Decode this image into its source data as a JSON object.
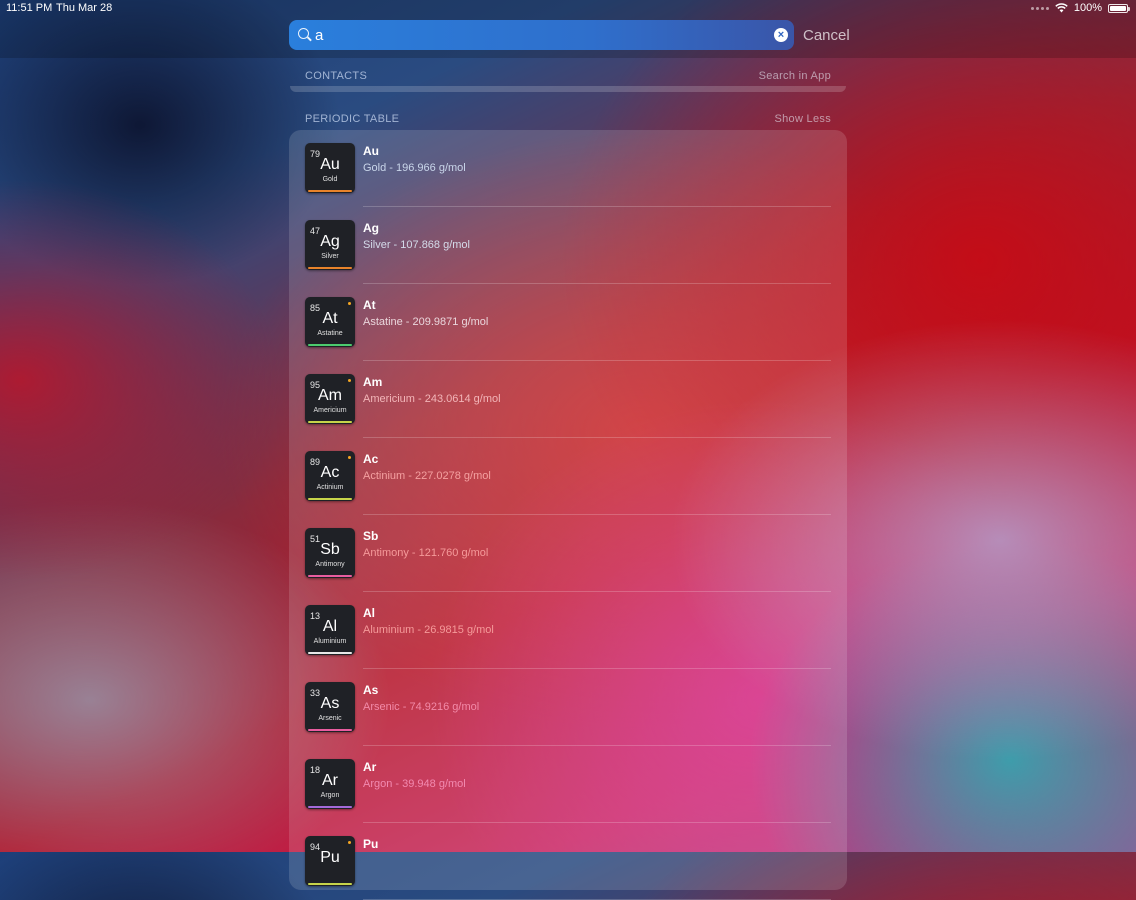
{
  "status_bar": {
    "time": "11:51 PM",
    "date": "Thu Mar 28",
    "battery": "100%"
  },
  "search": {
    "value": "a",
    "cancel_label": "Cancel",
    "clear_icon": "×"
  },
  "contacts_section": {
    "title": "CONTACTS",
    "action": "Search in App"
  },
  "periodic_section": {
    "title": "PERIODIC TABLE",
    "action": "Show Less"
  },
  "results": [
    {
      "number": "79",
      "symbol": "Au",
      "name": "Gold",
      "subtitle": "Gold - 196.966 g/mol",
      "bar_color": "#e8832a",
      "sub_color": "#c9d6ea",
      "dot": false
    },
    {
      "number": "47",
      "symbol": "Ag",
      "name": "Silver",
      "subtitle": "Silver - 107.868 g/mol",
      "bar_color": "#e8832a",
      "sub_color": "#d4dbea",
      "dot": false
    },
    {
      "number": "85",
      "symbol": "At",
      "name": "Astatine",
      "subtitle": "Astatine - 209.9871 g/mol",
      "bar_color": "#4ccb6e",
      "sub_color": "#ead6dc",
      "dot": true
    },
    {
      "number": "95",
      "symbol": "Am",
      "name": "Americium",
      "subtitle": "Americium - 243.0614 g/mol",
      "bar_color": "#c6d44a",
      "sub_color": "#f2b5b8",
      "dot": true
    },
    {
      "number": "89",
      "symbol": "Ac",
      "name": "Actinium",
      "subtitle": "Actinium - 227.0278 g/mol",
      "bar_color": "#c6d44a",
      "sub_color": "#f4a0a0",
      "dot": true
    },
    {
      "number": "51",
      "symbol": "Sb",
      "name": "Antimony",
      "subtitle": "Antimony - 121.760 g/mol",
      "bar_color": "#e95da0",
      "sub_color": "#f59a9a",
      "dot": false
    },
    {
      "number": "13",
      "symbol": "Al",
      "name": "Aluminium",
      "subtitle": "Aluminium - 26.9815 g/mol",
      "bar_color": "#e8e8e8",
      "sub_color": "#f59a9a",
      "dot": false
    },
    {
      "number": "33",
      "symbol": "As",
      "name": "Arsenic",
      "subtitle": "Arsenic - 74.9216 g/mol",
      "bar_color": "#e95da0",
      "sub_color": "#f28aa8",
      "dot": false
    },
    {
      "number": "18",
      "symbol": "Ar",
      "name": "Argon",
      "subtitle": "Argon - 39.948 g/mol",
      "bar_color": "#a36ad9",
      "sub_color": "#f28ab0",
      "dot": false
    },
    {
      "number": "94",
      "symbol": "Pu",
      "name": "",
      "subtitle": "",
      "bar_color": "#c6d44a",
      "sub_color": "#f28ab0",
      "dot": true
    }
  ]
}
